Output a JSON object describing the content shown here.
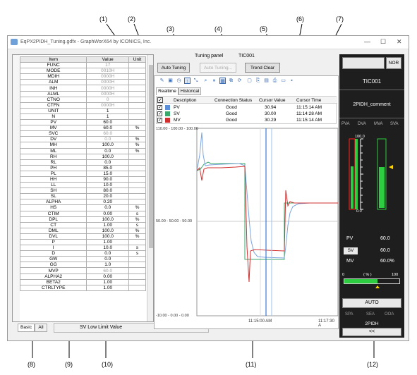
{
  "callouts": [
    "(1)",
    "(2)",
    "(3)",
    "(4)",
    "(5)",
    "(6)",
    "(7)",
    "(8)",
    "(9)",
    "(10)",
    "(11)",
    "(12)"
  ],
  "window": {
    "title": "EqPX2PIDH_Tuning.gdfx - GraphWorX64 by ICONICS, Inc."
  },
  "params": {
    "headers": [
      "Item",
      "Value",
      "Unit"
    ],
    "rows": [
      {
        "item": "FUNC",
        "value": "17",
        "unit": "",
        "gray": true
      },
      {
        "item": "MODE",
        "value": "0010H",
        "unit": "",
        "gray": true,
        "mark": true
      },
      {
        "item": "MDIH",
        "value": "0000H",
        "unit": "",
        "gray": true,
        "mark": true
      },
      {
        "item": "ALM",
        "value": "0000H",
        "unit": "",
        "gray": true,
        "mark": true
      },
      {
        "item": "INH",
        "value": "0000H",
        "unit": "",
        "gray": true,
        "mark": true
      },
      {
        "item": "ALML",
        "value": "0000H",
        "unit": "",
        "gray": true,
        "mark": true
      },
      {
        "item": "CTNO",
        "value": "0",
        "unit": "",
        "gray": true
      },
      {
        "item": "CTFN",
        "value": "0000H",
        "unit": "",
        "gray": true
      },
      {
        "item": "UNIT",
        "value": "1",
        "unit": ""
      },
      {
        "item": "N",
        "value": "1",
        "unit": ""
      },
      {
        "item": "PV",
        "value": "60.0",
        "unit": ""
      },
      {
        "item": "MV",
        "value": "60.0",
        "unit": "%"
      },
      {
        "item": "SVC",
        "value": "60.0",
        "unit": "",
        "gray": true
      },
      {
        "item": "DV",
        "value": "0.0",
        "unit": "%",
        "gray": true
      },
      {
        "item": "MH",
        "value": "100.0",
        "unit": "%"
      },
      {
        "item": "ML",
        "value": "0.0",
        "unit": "%"
      },
      {
        "item": "RH",
        "value": "100.0",
        "unit": ""
      },
      {
        "item": "RL",
        "value": "0.0",
        "unit": ""
      },
      {
        "item": "PH",
        "value": "85.0",
        "unit": ""
      },
      {
        "item": "PL",
        "value": "15.0",
        "unit": ""
      },
      {
        "item": "HH",
        "value": "90.0",
        "unit": ""
      },
      {
        "item": "LL",
        "value": "10.0",
        "unit": ""
      },
      {
        "item": "SH",
        "value": "80.0",
        "unit": ""
      },
      {
        "item": "SL",
        "value": "20.0",
        "unit": ""
      },
      {
        "item": "ALPHA",
        "value": "0.20",
        "unit": ""
      },
      {
        "item": "HS",
        "value": "0.0",
        "unit": "%"
      },
      {
        "item": "CTIM",
        "value": "0.00",
        "unit": "s"
      },
      {
        "item": "DPL",
        "value": "100.0",
        "unit": "%"
      },
      {
        "item": "CT",
        "value": "1.00",
        "unit": "s"
      },
      {
        "item": "DML",
        "value": "100.0",
        "unit": "%"
      },
      {
        "item": "DVL",
        "value": "100.0",
        "unit": "%"
      },
      {
        "item": "P",
        "value": "1.00",
        "unit": ""
      },
      {
        "item": "I",
        "value": "10.0",
        "unit": "s"
      },
      {
        "item": "D",
        "value": "0.0",
        "unit": "s"
      },
      {
        "item": "GW",
        "value": "0.0",
        "unit": ""
      },
      {
        "item": "GG",
        "value": "1.0",
        "unit": ""
      },
      {
        "item": "MVP",
        "value": "60.0",
        "unit": "",
        "gray": true
      },
      {
        "item": "ALPHA2",
        "value": "0.00",
        "unit": ""
      },
      {
        "item": "BETA2",
        "value": "1.00",
        "unit": ""
      },
      {
        "item": "CTRLTYPE",
        "value": "1.00",
        "unit": ""
      }
    ]
  },
  "bottom": {
    "basic_tab": "Basic",
    "all_tab": "All",
    "description": "SV Low Limit Value"
  },
  "tuning": {
    "panel_title": "Tuning panel",
    "tag": "TIC001",
    "auto_tuning": "Auto Tuning",
    "auto_tuning_progress": "Auto Tuning...",
    "trend_clear": "Trend Clear"
  },
  "trend": {
    "tabs": [
      "Realtime",
      "Historical"
    ],
    "columns": [
      "Description",
      "Connection Status",
      "Cursor Value",
      "Cursor Time"
    ],
    "rows": [
      {
        "name": "PV",
        "status": "Good",
        "value": "30.94",
        "time": "11:15:14 AM",
        "color": "#5b8fd9"
      },
      {
        "name": "SV",
        "status": "Good",
        "value": "30.00",
        "time": "11:14:28 AM",
        "color": "#3aa86b"
      },
      {
        "name": "MV",
        "status": "Good",
        "value": "30.29",
        "time": "11:15:14 AM",
        "color": "#d03030"
      }
    ],
    "y_top": "110.00 - 100.00 - 100.00",
    "y_mid": "50.00 - 50.00 - 50.00",
    "y_bot": "-10.00 - 0.00 - 0.00",
    "x_label1": "11:15:00 AM",
    "x_label2": "11:17:30 A"
  },
  "faceplate": {
    "mode_btn": "NOR",
    "tag": "TIC001",
    "comment": "2PIDH_comment",
    "bar_labels": [
      "PVA",
      "DVA",
      "MVA",
      "SVA"
    ],
    "scale_top": "100.0",
    "scale_bot": "0.0",
    "pv_label": "PV",
    "pv_value": "60.0",
    "sv_label": "SV",
    "sv_value": "60.0",
    "mv_label": "MV",
    "mv_value": "60.0%",
    "mv_scale_min": "0",
    "mv_scale_unit": "( % )",
    "mv_scale_max": "100",
    "mv_level": 0.6,
    "auto_btn": "AUTO",
    "status_labels": [
      "SPA",
      "SEA",
      "OOA"
    ],
    "type_label": "2PIDH",
    "collapse_btn": "<<",
    "colors": {
      "bar_green": "#2ecc40",
      "bar_red": "#e0201b",
      "marker": "#ffd700"
    }
  }
}
